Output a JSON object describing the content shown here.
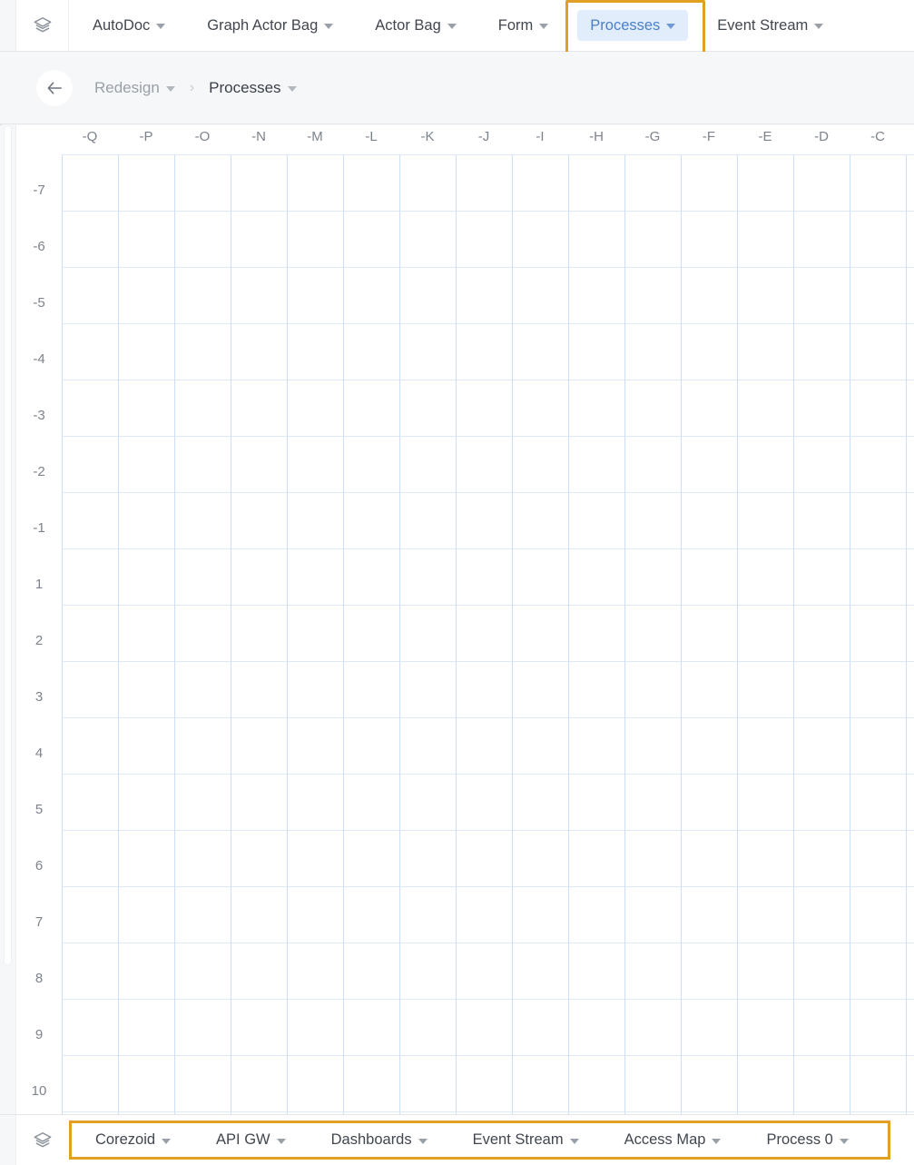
{
  "topbar": {
    "logo_icon": "layers-icon",
    "tabs": [
      {
        "label": "AutoDoc",
        "active": false,
        "focused": false
      },
      {
        "label": "Graph Actor Bag",
        "active": false,
        "focused": false
      },
      {
        "label": "Actor Bag",
        "active": false,
        "focused": false
      },
      {
        "label": "Form",
        "active": false,
        "focused": false
      },
      {
        "label": "Processes",
        "active": true,
        "focused": true
      },
      {
        "label": "Event Stream",
        "active": false,
        "focused": false
      }
    ]
  },
  "breadcrumb": {
    "back_icon": "back-arrow-icon",
    "separator": "›",
    "items": [
      {
        "label": "Redesign",
        "current": false
      },
      {
        "label": "Processes",
        "current": true
      }
    ]
  },
  "canvas": {
    "column_labels": [
      "-Q",
      "-P",
      "-O",
      "-N",
      "-M",
      "-L",
      "-K",
      "-J",
      "-I",
      "-H",
      "-G",
      "-F",
      "-E",
      "-D",
      "-C"
    ],
    "row_labels": [
      "-7",
      "-6",
      "-5",
      "-4",
      "-3",
      "-2",
      "-1",
      "1",
      "2",
      "3",
      "4",
      "5",
      "6",
      "7",
      "8",
      "9",
      "10"
    ],
    "cell_size": 62,
    "grid_line_color": "#cfe0f5",
    "background": "#ffffff"
  },
  "bottombar": {
    "logo_icon": "layers-icon",
    "items": [
      {
        "label": "Corezoid"
      },
      {
        "label": "API GW"
      },
      {
        "label": "Dashboards"
      },
      {
        "label": "Event Stream"
      },
      {
        "label": "Access Map"
      },
      {
        "label": "Process 0"
      }
    ]
  },
  "colors": {
    "highlight_orange": "#e0a023",
    "active_tab_bg": "#e2edfb",
    "active_tab_text": "#4a7fc9",
    "text_primary": "#41464f",
    "text_muted": "#9aa0a8"
  }
}
